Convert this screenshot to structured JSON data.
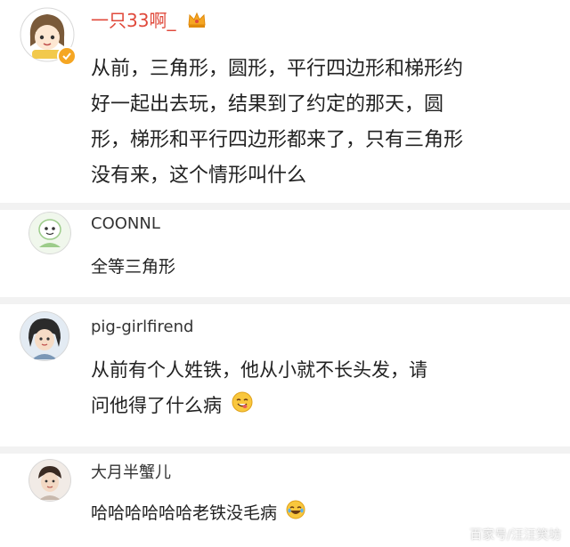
{
  "post": {
    "username": "一只33啊_",
    "crown_icon": "crown-icon",
    "verified_icon": "verified-badge-icon",
    "lines": [
      "从前，三角形，圆形，平行四边形和梯形约",
      "好一起出去玩，结果到了约定的那天，圆",
      "形，梯形和平行四边形都来了，只有三角形",
      "没有来，这个情形叫什么"
    ],
    "username_color": "#e0493b"
  },
  "comments": [
    {
      "username": "COONNL",
      "text_lines": [
        "全等三角形"
      ]
    },
    {
      "username": "pig-girlfirend",
      "text_lines": [
        "从前有个人姓铁，他从小就不长头发，请",
        "问他得了什么病"
      ],
      "emoji": "yum-face-emoji"
    },
    {
      "username": "大月半蟹儿",
      "text_lines": [
        "哈哈哈哈哈哈老铁没毛病"
      ],
      "emoji": "laughing-face-emoji"
    }
  ],
  "watermark": "百家号/汪汪笑坊"
}
